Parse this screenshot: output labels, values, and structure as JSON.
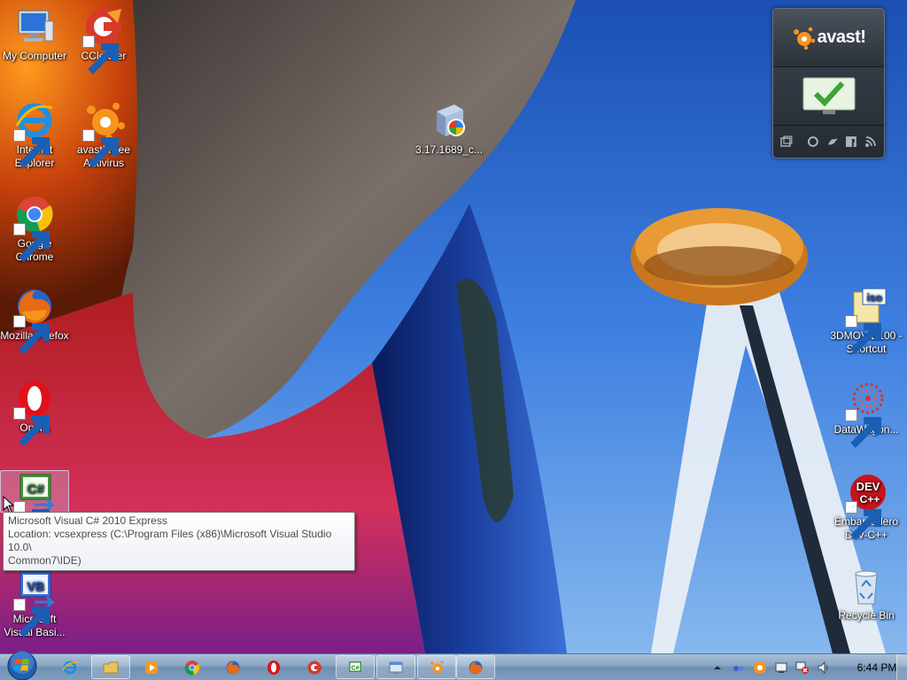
{
  "desktop": {
    "left_icons": [
      {
        "id": "my-computer",
        "label": "My Computer"
      },
      {
        "id": "ccleaner",
        "label": "CCleaner"
      },
      {
        "id": "internet-explorer",
        "label": "Internet Explorer"
      },
      {
        "id": "avast-free-antivirus",
        "label": "avast! Free Antivirus"
      },
      {
        "id": "google-chrome",
        "label": "Google Chrome"
      },
      {
        "id": "mozilla-firefox",
        "label": "Mozilla Firefox"
      },
      {
        "id": "opera",
        "label": "Opera"
      },
      {
        "id": "visual-csharp",
        "label": ""
      },
      {
        "id": "visual-basic",
        "label": "Microsoft Visual Basi..."
      }
    ],
    "center_icons": [
      {
        "id": "installer-file",
        "label": "3.17.1689_c..."
      }
    ],
    "right_icons": [
      {
        "id": "3dmovie-iso",
        "label": "3DMOVIE100 - Shortcut"
      },
      {
        "id": "datawagon",
        "label": "DataWagon..."
      },
      {
        "id": "embarcadero-devcpp",
        "label": "Embarcadero Dev-C++"
      },
      {
        "id": "recycle-bin",
        "label": "Recycle Bin"
      }
    ]
  },
  "tooltip": {
    "line1": "Microsoft Visual C# 2010 Express",
    "line2": "Location: vcsexpress (C:\\Program Files (x86)\\Microsoft Visual Studio 10.0\\",
    "line3": "Common7\\IDE)"
  },
  "avast_widget": {
    "logo": "avast!",
    "status": "protected-check-icon",
    "accent_color": "#f7941d"
  },
  "taskbar": {
    "items": [
      {
        "id": "internet-explorer",
        "icon": "ie-icon",
        "open": false
      },
      {
        "id": "windows-explorer",
        "icon": "folder-icon",
        "open": true
      },
      {
        "id": "media-player",
        "icon": "media-player-icon",
        "open": false
      },
      {
        "id": "chrome",
        "icon": "chrome-icon",
        "open": false
      },
      {
        "id": "firefox",
        "icon": "firefox-icon",
        "open": false
      },
      {
        "id": "opera",
        "icon": "opera-icon",
        "open": false
      },
      {
        "id": "ccleaner",
        "icon": "ccleaner-icon",
        "open": false
      },
      {
        "id": "visual-csharp",
        "icon": "csharp-icon",
        "open": true
      },
      {
        "id": "remote-app",
        "icon": "window-app-icon",
        "open": true
      },
      {
        "id": "avast",
        "icon": "avast-icon",
        "open": true
      },
      {
        "id": "firefox-window",
        "icon": "firefox-icon",
        "open": true
      }
    ],
    "clock": "6:44 PM"
  }
}
